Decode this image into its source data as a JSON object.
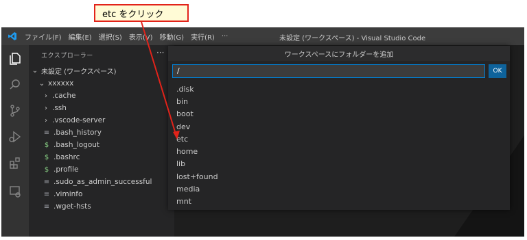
{
  "annotation": {
    "callout_text": "etc をクリック",
    "arrow_color": "#e2231a"
  },
  "titlebar": {
    "menu": [
      "ファイル(F)",
      "編集(E)",
      "選択(S)",
      "表示(V)",
      "移動(G)",
      "実行(R)",
      "···"
    ],
    "title": "未設定 (ワークスペース) - Visual Studio Code"
  },
  "activitybar": {
    "icons": [
      "explorer-icon",
      "search-icon",
      "source-control-icon",
      "run-debug-icon",
      "extensions-icon",
      "remote-explorer-icon"
    ]
  },
  "sidebar": {
    "title": "エクスプローラー",
    "more": "···",
    "workspace": "未設定 (ワークスペース)",
    "root_folder": "xxxxxx",
    "items": [
      {
        "name": ".cache",
        "type": "folder"
      },
      {
        "name": ".ssh",
        "type": "folder"
      },
      {
        "name": ".vscode-server",
        "type": "folder"
      },
      {
        "name": ".bash_history",
        "type": "file"
      },
      {
        "name": ".bash_logout",
        "type": "shell"
      },
      {
        "name": ".bashrc",
        "type": "shell"
      },
      {
        "name": ".profile",
        "type": "shell"
      },
      {
        "name": ".sudo_as_admin_successful",
        "type": "file"
      },
      {
        "name": ".viminfo",
        "type": "file"
      },
      {
        "name": ".wget-hsts",
        "type": "file"
      }
    ]
  },
  "quickpick": {
    "title": "ワークスペースにフォルダーを追加",
    "input_value": "/",
    "ok_label": "OK",
    "items": [
      ".disk",
      "bin",
      "boot",
      "dev",
      "etc",
      "home",
      "lib",
      "lost+found",
      "media",
      "mnt"
    ]
  },
  "colors": {
    "accent": "#007fd4",
    "ok_button": "#0e639c",
    "shell_icon": "#89d185",
    "titlebar": "#3c3c3c",
    "sidebar": "#252526",
    "editor": "#1e1e1e"
  }
}
